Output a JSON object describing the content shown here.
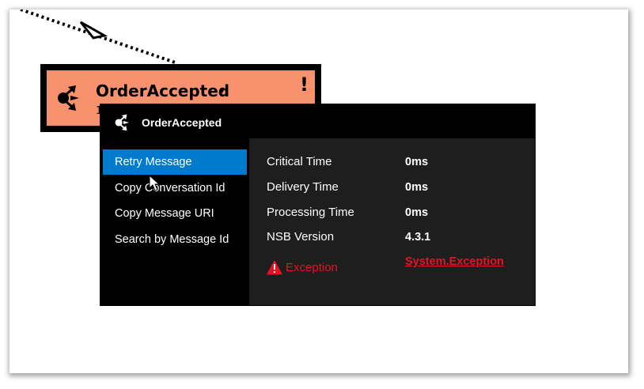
{
  "node": {
    "title": "OrderAccepted",
    "dropdown_glyph": "▾",
    "warning_glyph": "!",
    "subtext": "1",
    "icon": "message-icon",
    "fill_color": "#f7916e"
  },
  "popup": {
    "title": "OrderAccepted",
    "icon": "message-icon",
    "menu": [
      {
        "label": "Retry Message",
        "selected": true
      },
      {
        "label": "Copy Conversation Id",
        "selected": false
      },
      {
        "label": "Copy Message URI",
        "selected": false
      },
      {
        "label": "Search by Message Id",
        "selected": false
      }
    ],
    "details": [
      {
        "label": "Critical Time",
        "value": "0ms"
      },
      {
        "label": "Delivery Time",
        "value": "0ms"
      },
      {
        "label": "Processing Time",
        "value": "0ms"
      },
      {
        "label": "NSB Version",
        "value": "4.3.1"
      }
    ],
    "exception": {
      "icon": "warning-triangle-icon",
      "label": "Exception",
      "value": "System.Exception",
      "color": "#e81123"
    },
    "selected_color": "#007acc"
  }
}
